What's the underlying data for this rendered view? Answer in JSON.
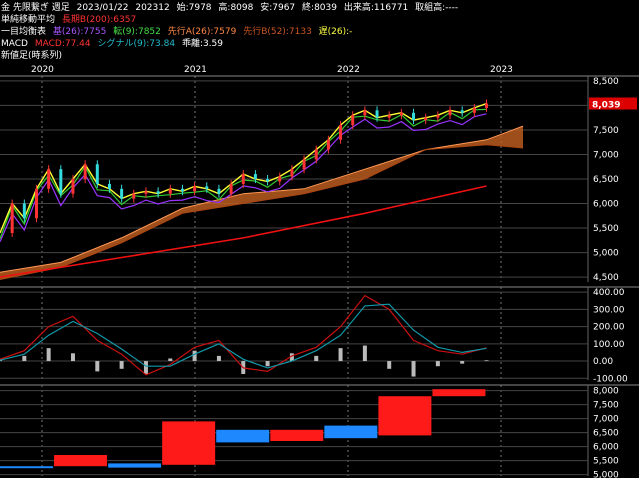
{
  "header": {
    "line1": {
      "name": "金 先限繋ぎ 週足",
      "date": "2023/01/22",
      "contract": "202312",
      "open": "始:7978",
      "high": "高:8098",
      "low": "安:7967",
      "close": "終:8039",
      "volume": "出来高:116771",
      "oi": "取組高:----"
    },
    "line2": {
      "label": "単純移動平均",
      "ma": "長期B(200):6357"
    },
    "line3": {
      "label": "一目均衡表",
      "base": "基(26):7755",
      "conv": "転(9):7852",
      "spanA": "先行A(26):7579",
      "spanB": "先行B(52):7133",
      "lag": "遅(26):-"
    },
    "line4": {
      "label": "MACD",
      "macd": "MACD:77.44",
      "signal": "シグナル(9):73.84",
      "diff": "乖離:3.59"
    },
    "line5": {
      "label": "新値足(時系列)"
    }
  },
  "colors": {
    "price_line": "#ffff33",
    "ma200": "#ee1111",
    "cloud": "#b85c1e",
    "base": "#9933ff",
    "conv": "#33cc33",
    "macd": "#cc1111",
    "signal": "#1199aa",
    "up_block": "#ff1a1a",
    "down_block": "#1e88ff",
    "price_tag": "#dd0000"
  },
  "chart_data": [
    {
      "type": "line",
      "title": "金 先限繋ぎ 週足",
      "x_ticks": [
        "2020",
        "2021",
        "2022",
        "2023"
      ],
      "y_ticks": [
        4500,
        5000,
        5500,
        6000,
        6500,
        7000,
        7500,
        8000,
        8500
      ],
      "ylim": [
        4400,
        8600
      ],
      "current_price": "8,039",
      "series": [
        {
          "name": "",
          "role": "price",
          "x": [
            0,
            4,
            8,
            12,
            16,
            20,
            24,
            28,
            32,
            36,
            40,
            44,
            48,
            52,
            56,
            60,
            64,
            68,
            72,
            76,
            80,
            84,
            88,
            92,
            96,
            100,
            104,
            108,
            112,
            116,
            120,
            124,
            128,
            132,
            136,
            140,
            144,
            148,
            152,
            156,
            160
          ],
          "values": [
            5400,
            6000,
            5700,
            6300,
            6700,
            6200,
            6500,
            6800,
            6400,
            6300,
            6100,
            6200,
            6250,
            6200,
            6300,
            6250,
            6350,
            6300,
            6200,
            6400,
            6600,
            6500,
            6450,
            6550,
            6700,
            6900,
            7100,
            7300,
            7600,
            7800,
            7900,
            7750,
            7800,
            7850,
            7700,
            7750,
            7800,
            7900,
            7850,
            7950,
            8039
          ]
        },
        {
          "name": "",
          "role": "ma200",
          "x": [
            0,
            40,
            80,
            120,
            160
          ],
          "values": [
            4500,
            4900,
            5300,
            5800,
            6357
          ]
        },
        {
          "name": "",
          "role": "span_a",
          "x": [
            0,
            20,
            40,
            60,
            80,
            100,
            120,
            140,
            160,
            172
          ],
          "values": [
            4600,
            4800,
            5300,
            5900,
            6200,
            6300,
            6700,
            7100,
            7300,
            7579
          ]
        },
        {
          "name": "",
          "role": "span_b",
          "x": [
            0,
            20,
            40,
            60,
            80,
            100,
            120,
            140,
            160,
            172
          ],
          "values": [
            4450,
            4700,
            5200,
            5800,
            6000,
            6200,
            6500,
            7100,
            7200,
            7133
          ]
        }
      ]
    },
    {
      "type": "line",
      "title": "MACD",
      "y_ticks": [
        -100,
        0,
        100,
        200,
        300,
        400
      ],
      "ylim": [
        -110,
        430
      ],
      "series": [
        {
          "name": "MACD",
          "role": "macd",
          "x": [
            0,
            8,
            16,
            24,
            32,
            40,
            48,
            56,
            64,
            72,
            80,
            88,
            96,
            104,
            112,
            120,
            128,
            136,
            144,
            152,
            160
          ],
          "values": [
            10,
            60,
            200,
            260,
            120,
            40,
            -80,
            -20,
            80,
            120,
            -40,
            -60,
            30,
            80,
            200,
            380,
            300,
            120,
            60,
            40,
            77
          ]
        },
        {
          "name": "シグナル(9)",
          "role": "signal",
          "x": [
            0,
            8,
            16,
            24,
            32,
            40,
            48,
            56,
            64,
            72,
            80,
            88,
            96,
            104,
            112,
            120,
            128,
            136,
            144,
            152,
            160
          ],
          "values": [
            5,
            40,
            150,
            230,
            160,
            70,
            -30,
            -30,
            40,
            100,
            10,
            -40,
            0,
            60,
            150,
            320,
            330,
            180,
            80,
            50,
            74
          ]
        }
      ]
    },
    {
      "type": "bar",
      "title": "新値足(時系列)",
      "y_ticks": [
        5000,
        5500,
        6000,
        6500,
        7000,
        7500,
        8000
      ],
      "ylim": [
        4950,
        8200
      ],
      "blocks": [
        {
          "dir": "down",
          "from": 5300,
          "to": 5250
        },
        {
          "dir": "up",
          "from": 5300,
          "to": 5700
        },
        {
          "dir": "down",
          "from": 5400,
          "to": 5250
        },
        {
          "dir": "up",
          "from": 5350,
          "to": 6900
        },
        {
          "dir": "down",
          "from": 6600,
          "to": 6150
        },
        {
          "dir": "up",
          "from": 6200,
          "to": 6600
        },
        {
          "dir": "down",
          "from": 6750,
          "to": 6300
        },
        {
          "dir": "up",
          "from": 6400,
          "to": 7800
        },
        {
          "dir": "up",
          "from": 7800,
          "to": 8050
        }
      ]
    }
  ]
}
